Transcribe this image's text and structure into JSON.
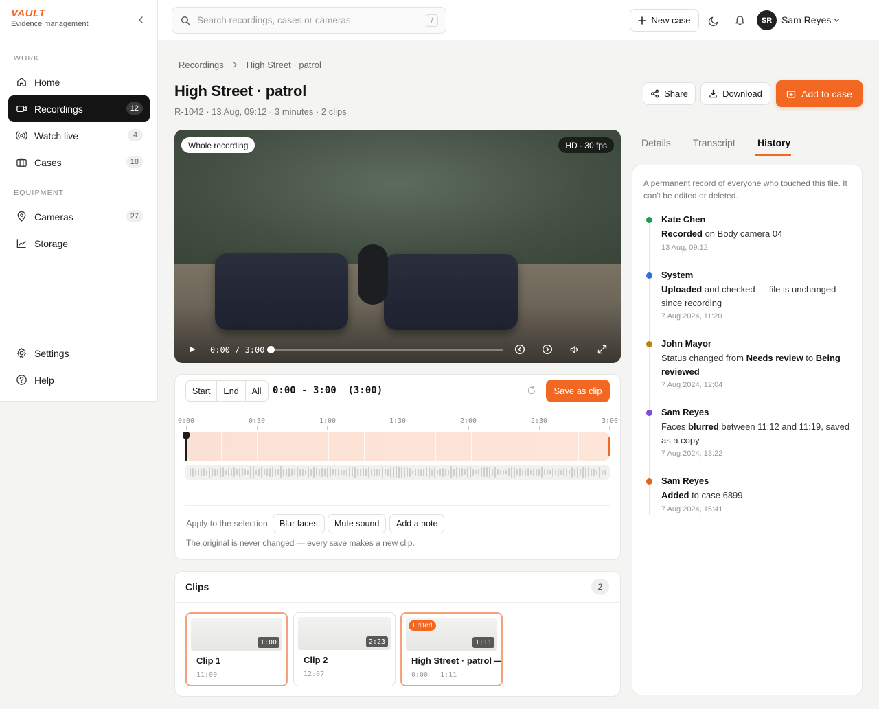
{
  "brand": {
    "logo": "VAULT",
    "subtitle": "Evidence management"
  },
  "colors": {
    "accent": "#f26722",
    "dark": "#141414"
  },
  "sidebar": {
    "sections": [
      {
        "label": "WORK"
      },
      {
        "label": "EQUIPMENT"
      }
    ],
    "items": [
      {
        "label": "Home",
        "icon": "home-icon",
        "badge": ""
      },
      {
        "label": "Recordings",
        "icon": "video-camera-icon",
        "badge": "12",
        "active": true
      },
      {
        "label": "Watch live",
        "icon": "broadcast-icon",
        "badge": "4"
      },
      {
        "label": "Cases",
        "icon": "briefcase-icon",
        "badge": "18"
      },
      {
        "label": "Cameras",
        "icon": "location-pin-icon",
        "badge": "27"
      },
      {
        "label": "Storage",
        "icon": "chart-line-icon",
        "badge": ""
      }
    ],
    "footer": [
      {
        "label": "Settings",
        "icon": "gear-icon"
      },
      {
        "label": "Help",
        "icon": "help-circle-icon"
      }
    ]
  },
  "topbar": {
    "search_placeholder": "Search recordings, cases or cameras",
    "search_shortcut": "/",
    "new_case_label": "New case",
    "user": {
      "initials": "SR",
      "name": "Sam Reyes"
    }
  },
  "header": {
    "breadcrumb": [
      "Recordings",
      "High Street · patrol"
    ],
    "title": "High Street · patrol",
    "meta": "R-1042 · 13 Aug, 09:12 · 3 minutes · 2 clips",
    "share_label": "Share",
    "download_label": "Download",
    "add_to_case_label": "Add to case"
  },
  "player": {
    "scope_label": "Whole recording",
    "quality_label": "HD · 30 fps",
    "time": "0:00 / 3:00",
    "progress": 0
  },
  "editor": {
    "segments": [
      "Start",
      "End",
      "All"
    ],
    "range": "0:00 - 3:00  (3:00)",
    "save_clip_label": "Save as clip",
    "ticks": [
      "0:00",
      "0:30",
      "1:00",
      "1:30",
      "2:00",
      "2:30",
      "3:00"
    ],
    "apply_label": "Apply to the selection",
    "actions": [
      "Blur faces",
      "Mute sound",
      "Add a note"
    ],
    "note": "The original is never changed — every save makes a new clip."
  },
  "clips": {
    "title": "Clips",
    "count": "2",
    "items": [
      {
        "name": "Clip 1",
        "sub": "11:00",
        "duration": "1:00",
        "edited": ""
      },
      {
        "name": "Clip 2",
        "sub": "12:07",
        "duration": "2:23",
        "edited": ""
      },
      {
        "name": "High Street · patrol —",
        "sub": "0:00 – 1:11",
        "duration": "1:11",
        "edited": "Edited"
      }
    ]
  },
  "tabs": [
    "Details",
    "Transcript",
    "History"
  ],
  "history": {
    "intro": "A permanent record of everyone who touched this file. It can't be edited or deleted.",
    "events": [
      {
        "who": "Kate Chen",
        "action": "Recorded",
        "rest": " on Body camera 04",
        "when": "13 Aug, 09:12",
        "color": "#1a9e4b"
      },
      {
        "who": "System",
        "action": "Uploaded",
        "rest": " and checked — file is unchanged since recording",
        "when": "7 Aug 2024, 11:20",
        "color": "#2f6fde"
      },
      {
        "who": "John Mayor",
        "pre": "Status changed from ",
        "action": "Needs review",
        "mid": " to ",
        "action2": "Being reviewed",
        "when": "7 Aug 2024, 12:04",
        "color": "#b8860b"
      },
      {
        "who": "Sam Reyes",
        "pre": "Faces ",
        "action": "blurred",
        "rest": " between 11:12 and 11:19, saved as a copy",
        "when": "7 Aug 2024, 13:22",
        "color": "#7a4fd6"
      },
      {
        "who": "Sam Reyes",
        "action": "Added",
        "rest": " to case 6899",
        "when": "7 Aug 2024, 15:41",
        "color": "#e0661f"
      }
    ]
  }
}
